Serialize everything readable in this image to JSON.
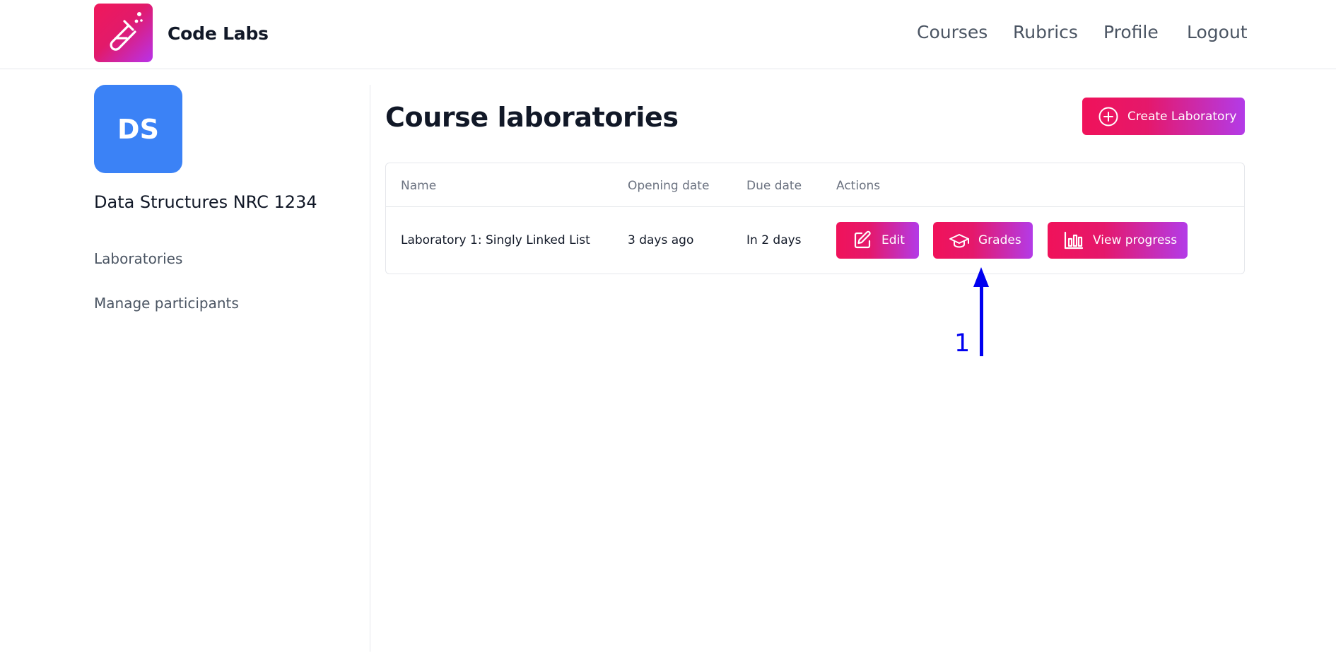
{
  "header": {
    "brand": "Code Labs",
    "nav": [
      "Courses",
      "Rubrics",
      "Profile",
      "Logout"
    ]
  },
  "sidebar": {
    "avatar_initials": "DS",
    "avatar_color": "#3b82f6",
    "course_name": "Data Structures NRC 1234",
    "links": [
      "Laboratories",
      "Manage participants"
    ]
  },
  "main": {
    "title": "Course laboratories",
    "create_button": "Create Laboratory",
    "table": {
      "columns": [
        "Name",
        "Opening date",
        "Due date",
        "Actions"
      ],
      "rows": [
        {
          "name": "Laboratory 1: Singly Linked List",
          "opening_date": "3 days ago",
          "due_date": "In 2 days",
          "actions": [
            "Edit",
            "Grades",
            "View progress"
          ]
        }
      ]
    }
  },
  "annotation": {
    "label": "1",
    "color": "#0000f0"
  },
  "colors": {
    "accent_start": "#f0125a",
    "accent_end": "#b33be8"
  },
  "icons": {
    "logo": "test-tube-icon",
    "create": "plus-circle-icon",
    "edit": "edit-icon",
    "grades": "graduation-cap-icon",
    "progress": "bar-chart-icon"
  }
}
